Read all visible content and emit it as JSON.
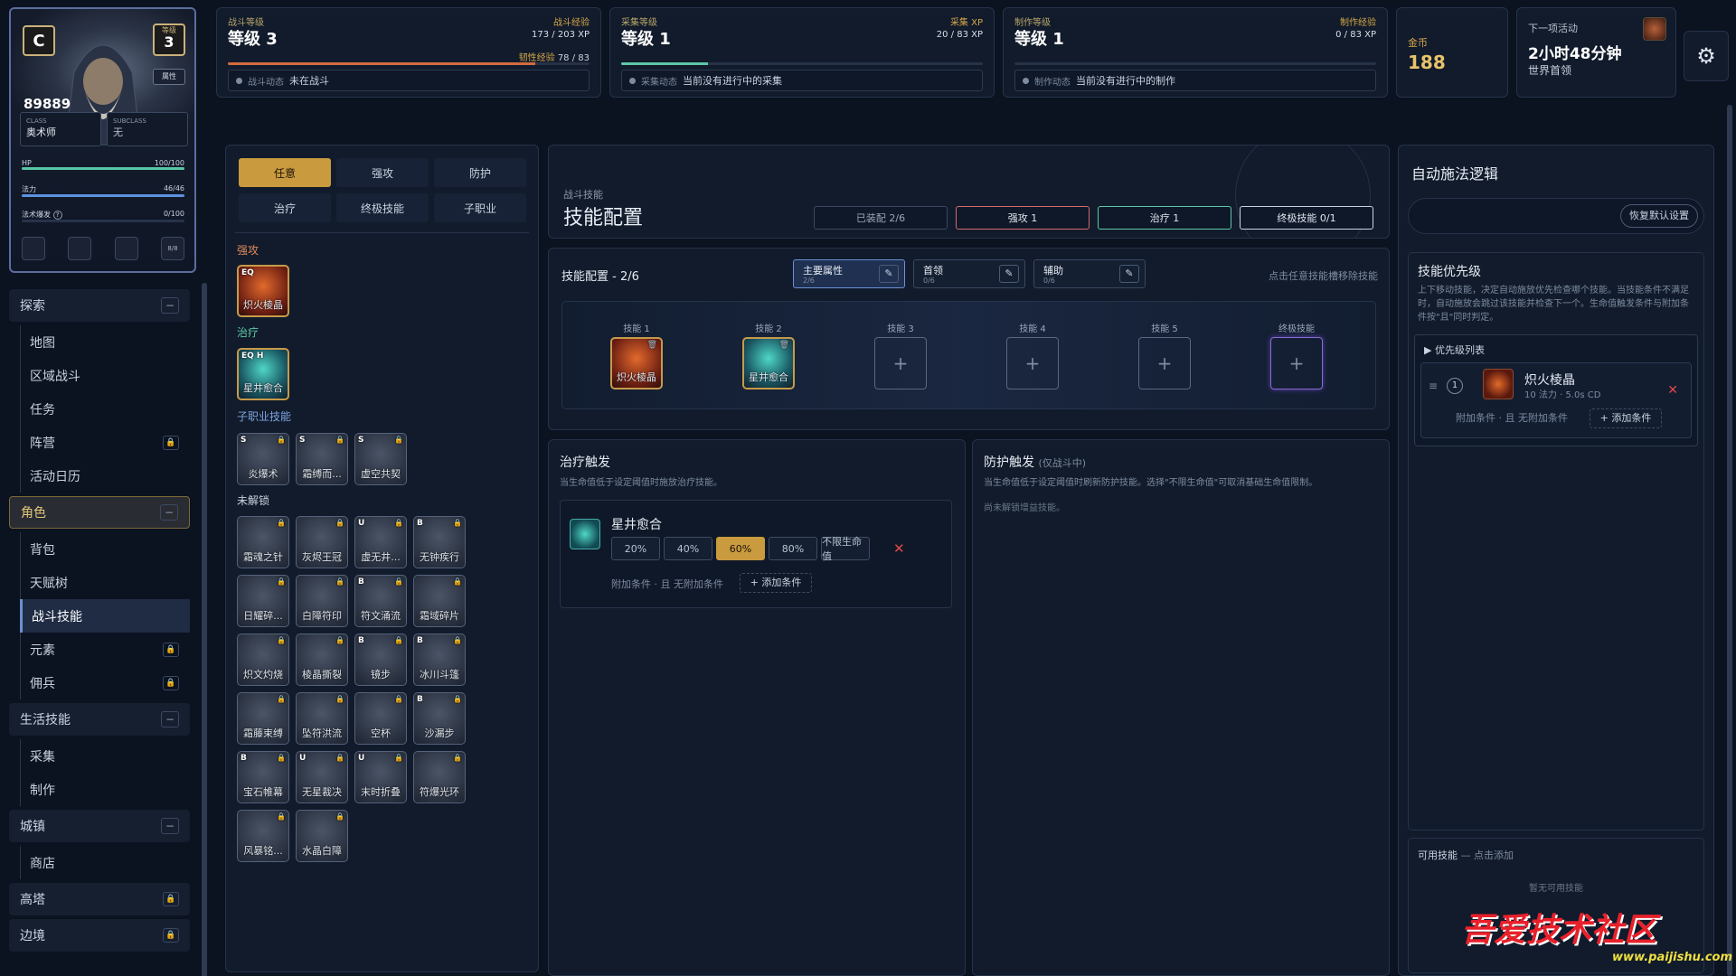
{
  "character": {
    "rank": "C",
    "level": "3",
    "level_tag": "等级",
    "btn": "属性",
    "power": "89889",
    "class_label": "CLASS",
    "class_value": "奥术师",
    "subclass_label": "SUBCLASS",
    "subclass_value": "无",
    "hp_label": "HP",
    "hp_value": "100/100",
    "hp_pct": 100,
    "mana_label": "法力",
    "mana_value": "46/46",
    "mana_pct": 100,
    "burst_label": "法术爆发",
    "burst_value": "0/100",
    "burst_pct": 0,
    "slot_btn": "8/8"
  },
  "nav": [
    {
      "type": "cat",
      "label": "探索",
      "btn": "−"
    },
    {
      "type": "item",
      "label": "地图"
    },
    {
      "type": "item",
      "label": "区域战斗"
    },
    {
      "type": "item",
      "label": "任务"
    },
    {
      "type": "item",
      "label": "阵营",
      "lock": true
    },
    {
      "type": "item",
      "label": "活动日历"
    },
    {
      "type": "cat",
      "label": "角色",
      "btn": "−",
      "active": true
    },
    {
      "type": "item",
      "label": "背包"
    },
    {
      "type": "item",
      "label": "天赋树"
    },
    {
      "type": "item",
      "label": "战斗技能",
      "active": true
    },
    {
      "type": "item",
      "label": "元素",
      "lock": true
    },
    {
      "type": "item",
      "label": "佣兵",
      "lock": true
    },
    {
      "type": "cat",
      "label": "生活技能",
      "btn": "−"
    },
    {
      "type": "item",
      "label": "采集"
    },
    {
      "type": "item",
      "label": "制作"
    },
    {
      "type": "cat",
      "label": "城镇",
      "btn": "−"
    },
    {
      "type": "item",
      "label": "商店"
    },
    {
      "type": "cat",
      "label": "高塔",
      "lockcat": true
    },
    {
      "type": "cat",
      "label": "边境",
      "lockcat": true
    }
  ],
  "topbar": {
    "combat": {
      "small": "战斗等级",
      "level": "等级 3",
      "xp_label": "战斗经验",
      "xp": "173 / 203 XP",
      "xp_pct": 85,
      "tough_label": "韧性经验",
      "tough": "78 / 83",
      "status_label": "战斗动态",
      "status": "未在战斗"
    },
    "gather": {
      "small": "采集等级",
      "level": "等级 1",
      "xp_label": "采集 XP",
      "xp": "20 / 83 XP",
      "xp_pct": 24,
      "status_label": "采集动态",
      "status": "当前没有进行中的采集"
    },
    "craft": {
      "small": "制作等级",
      "level": "等级 1",
      "xp_label": "制作经验",
      "xp": "0 / 83 XP",
      "xp_pct": 0,
      "status_label": "制作动态",
      "status": "当前没有进行中的制作"
    },
    "gold": {
      "label": "金币",
      "value": "188"
    },
    "event": {
      "label": "下一项活动",
      "time": "2小时48分钟",
      "name": "世界首领"
    }
  },
  "library": {
    "tabs": [
      "任意",
      "强攻",
      "防护",
      "治疗",
      "终极技能",
      "子职业"
    ],
    "active_tab": 0,
    "sec_offense": "强攻",
    "sec_heal": "治疗",
    "sec_sub": "子职业技能",
    "sec_locked": "未解锁",
    "offense": [
      {
        "name": "炽火棱晶",
        "tag": "EQ"
      }
    ],
    "heal": [
      {
        "name": "星井愈合",
        "tag": "EQ H"
      }
    ],
    "sub": [
      {
        "name": "炎爆术",
        "tag": "S"
      },
      {
        "name": "霜缚而...",
        "tag": "S"
      },
      {
        "name": "虚空共契",
        "tag": "S"
      }
    ],
    "locked": [
      {
        "name": "霜魂之针",
        "tag": ""
      },
      {
        "name": "灰烬王冠",
        "tag": ""
      },
      {
        "name": "虚无井...",
        "tag": "U"
      },
      {
        "name": "无钟疾行",
        "tag": "B"
      },
      {
        "name": "日耀碎...",
        "tag": ""
      },
      {
        "name": "白障符印",
        "tag": ""
      },
      {
        "name": "符文涌流",
        "tag": "B"
      },
      {
        "name": "霜域碎片",
        "tag": ""
      },
      {
        "name": "炽文灼烧",
        "tag": ""
      },
      {
        "name": "棱晶撕裂",
        "tag": ""
      },
      {
        "name": "镜步",
        "tag": "B"
      },
      {
        "name": "冰川斗篷",
        "tag": "B"
      },
      {
        "name": "霜藤束缚",
        "tag": ""
      },
      {
        "name": "坠符洪流",
        "tag": ""
      },
      {
        "name": "空杯",
        "tag": ""
      },
      {
        "name": "沙漏步",
        "tag": "B"
      },
      {
        "name": "宝石帷幕",
        "tag": "B"
      },
      {
        "name": "无星裁决",
        "tag": "U"
      },
      {
        "name": "末时折叠",
        "tag": "U"
      },
      {
        "name": "符爆光环",
        "tag": ""
      },
      {
        "name": "风暴铭...",
        "tag": ""
      },
      {
        "name": "水晶白障",
        "tag": ""
      }
    ]
  },
  "header": {
    "small": "战斗技能",
    "title": "技能配置",
    "badges": [
      "已装配 2/6",
      "强攻 1",
      "治疗 1",
      "终极技能 0/1"
    ]
  },
  "config": {
    "title": "技能配置 - 2/6",
    "tabs": [
      {
        "label": "主要属性",
        "sub": "2/6"
      },
      {
        "label": "首领",
        "sub": "0/6"
      },
      {
        "label": "辅助",
        "sub": "0/6"
      }
    ],
    "hint": "点击任意技能槽移除技能",
    "slots": [
      {
        "label": "技能 1",
        "skill": "炽火棱晶",
        "kind": "fire"
      },
      {
        "label": "技能 2",
        "skill": "星井愈合",
        "kind": "heal"
      },
      {
        "label": "技能 3"
      },
      {
        "label": "技能 4"
      },
      {
        "label": "技能 5"
      },
      {
        "label": "终极技能",
        "ult": true
      }
    ]
  },
  "heal_trigger": {
    "title": "治疗触发",
    "desc": "当生命值低于设定阈值时施放治疗技能。",
    "skill": "星井愈合",
    "options": [
      "20%",
      "40%",
      "60%",
      "80%",
      "不限生命值"
    ],
    "selected": 2,
    "cond_text": "附加条件 · 且",
    "cond_none": "无附加条件",
    "add_btn": "+ 添加条件"
  },
  "guard_trigger": {
    "title": "防护触发",
    "sub": "(仅战斗中)",
    "desc": "当生命值低于设定阈值时刷新防护技能。选择\"不限生命值\"可取消基础生命值限制。",
    "empty": "尚未解锁增益技能。"
  },
  "auto": {
    "title": "自动施法逻辑",
    "reset": "恢复默认设置",
    "prio_title": "技能优先级",
    "prio_desc": "上下移动技能，决定自动施放优先检查哪个技能。当技能条件不满足时，自动施放会跳过该技能并检查下一个。生命值触发条件与附加条件按\"且\"同时判定。",
    "list_title": "▶ 优先级列表",
    "entry": {
      "rank": "1",
      "name": "炽火棱晶",
      "meta": "10 法力 · 5.0s CD",
      "cond": "附加条件 · 且",
      "none": "无附加条件",
      "add": "+ 添加条件"
    },
    "avail_title": "可用技能",
    "avail_hint": "— 点击添加",
    "avail_empty": "暂无可用技能"
  },
  "watermark": {
    "text": "吾爱技术社区",
    "url": "www.paijishu.com"
  },
  "colors": {
    "gold": "#d4a64a",
    "accent": "#6b8fd6",
    "danger": "#e04848",
    "heal": "#5ec7a8"
  }
}
